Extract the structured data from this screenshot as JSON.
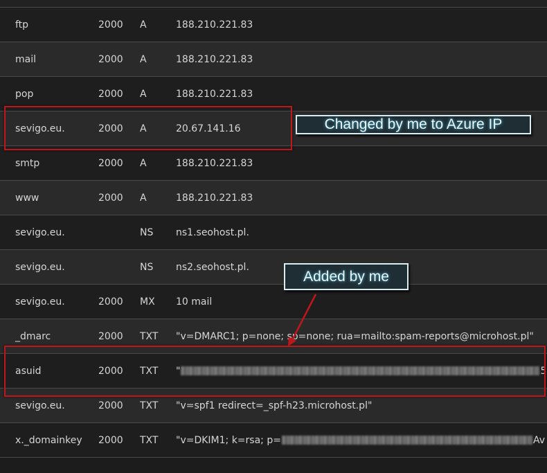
{
  "records": [
    {
      "name": "ftp",
      "ttl": "2000",
      "type": "A",
      "value": "188.210.221.83"
    },
    {
      "name": "mail",
      "ttl": "2000",
      "type": "A",
      "value": "188.210.221.83"
    },
    {
      "name": "pop",
      "ttl": "2000",
      "type": "A",
      "value": "188.210.221.83"
    },
    {
      "name": "sevigo.eu.",
      "ttl": "2000",
      "type": "A",
      "value": "20.67.141.16"
    },
    {
      "name": "smtp",
      "ttl": "2000",
      "type": "A",
      "value": "188.210.221.83"
    },
    {
      "name": "www",
      "ttl": "2000",
      "type": "A",
      "value": "188.210.221.83"
    },
    {
      "name": "sevigo.eu.",
      "ttl": "",
      "type": "NS",
      "value": "ns1.seohost.pl."
    },
    {
      "name": "sevigo.eu.",
      "ttl": "",
      "type": "NS",
      "value": "ns2.seohost.pl."
    },
    {
      "name": "sevigo.eu.",
      "ttl": "2000",
      "type": "MX",
      "value": "10 mail"
    },
    {
      "name": "_dmarc",
      "ttl": "2000",
      "type": "TXT",
      "value": "\"v=DMARC1; p=none; sp=none; rua=mailto:spam-reports@microhost.pl\""
    },
    {
      "name": "asuid",
      "ttl": "2000",
      "type": "TXT",
      "value_prefix": "\"",
      "value_suffix": "5"
    },
    {
      "name": "sevigo.eu.",
      "ttl": "2000",
      "type": "TXT",
      "value": "\"v=spf1 redirect=_spf-h23.microhost.pl\""
    },
    {
      "name": "x._domainkey",
      "ttl": "2000",
      "type": "TXT",
      "value_prefix": "\"v=DKIM1; k=rsa; p=",
      "value_suffix": "Av"
    }
  ],
  "annotations": {
    "changed": "Changed by me to Azure IP",
    "added": "Added by me",
    "color_box": "#c0171b",
    "color_callout_border": "#d9ecf0"
  }
}
